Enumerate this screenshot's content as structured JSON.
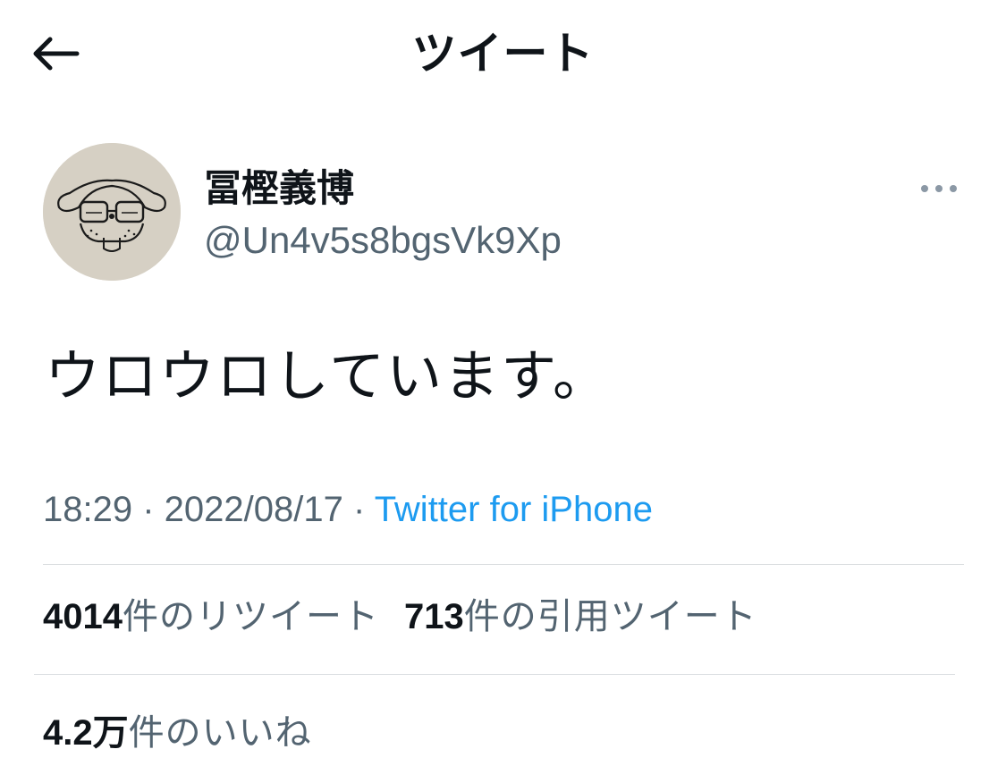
{
  "header": {
    "title": "ツイート",
    "back_icon": "arrow-left-icon"
  },
  "author": {
    "display_name": "冨樫義博",
    "handle": "@Un4v5s8bgsVk9Xp",
    "avatar_icon": "avatar-drawing",
    "more_icon": "more-horizontal-icon"
  },
  "tweet": {
    "text": "ウロウロしています。",
    "time": "18:29",
    "separator": " · ",
    "date": "2022/08/17",
    "source": "Twitter for iPhone"
  },
  "stats": {
    "retweets": {
      "count": "4014",
      "label": "件のリツイート"
    },
    "quotes": {
      "count": "713",
      "label": "件の引用ツイート"
    },
    "likes": {
      "count": "4.2万",
      "label": "件のいいね"
    }
  },
  "colors": {
    "text": "#0f1419",
    "secondary": "#536471",
    "link": "#1d9bf0",
    "divider": "#dadde0"
  }
}
